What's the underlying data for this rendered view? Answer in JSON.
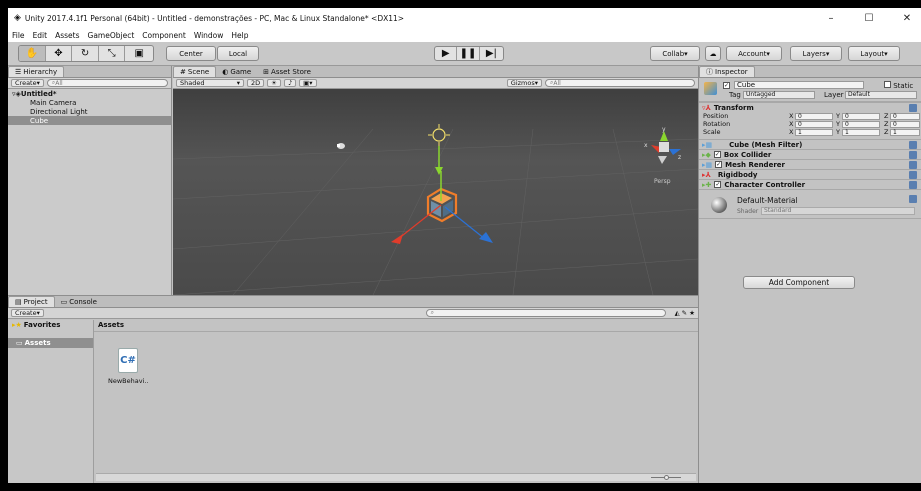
{
  "window": {
    "title": "Unity 2017.4.1f1 Personal (64bit) - Untitled - demonstrações - PC, Mac & Linux Standalone* <DX11>",
    "minimize": "–",
    "maximize": "☐",
    "close": "✕"
  },
  "menu": [
    "File",
    "Edit",
    "Assets",
    "GameObject",
    "Component",
    "Window",
    "Help"
  ],
  "toolbar": {
    "center_label": "Center",
    "local_label": "Local",
    "collab_label": "Collab",
    "account_label": "Account",
    "layers_label": "Layers",
    "layout_label": "Layout"
  },
  "hierarchy": {
    "tab": "Hierarchy",
    "create": "Create",
    "search": "All",
    "scene": "Untitled*",
    "items": [
      "Main Camera",
      "Directional Light",
      "Cube"
    ]
  },
  "scene": {
    "tabs": [
      "Scene",
      "Game",
      "Asset Store"
    ],
    "shading": "Shaded",
    "mode2d": "2D",
    "gizmos": "Gizmos",
    "search": "All",
    "persp": "Persp",
    "axis_x": "x",
    "axis_y": "y",
    "axis_z": "z"
  },
  "project": {
    "tabs": [
      "Project",
      "Console"
    ],
    "create": "Create",
    "favorites": "Favorites",
    "assets_header": "Assets",
    "assets_folder": "Assets",
    "file_name": "NewBehavi..",
    "file_icon": "C#"
  },
  "inspector": {
    "tab": "Inspector",
    "object_name": "Cube",
    "static_label": "Static",
    "tag_label": "Tag",
    "tag_value": "Untagged",
    "layer_label": "Layer",
    "layer_value": "Default",
    "transform": {
      "title": "Transform",
      "rows": [
        {
          "label": "Position",
          "x": "0",
          "y": "0",
          "z": "0"
        },
        {
          "label": "Rotation",
          "x": "0",
          "y": "0",
          "z": "0"
        },
        {
          "label": "Scale",
          "x": "1",
          "y": "1",
          "z": "1"
        }
      ]
    },
    "components": [
      "Cube (Mesh Filter)",
      "Box Collider",
      "Mesh Renderer",
      "Rigidbody",
      "Character Controller"
    ],
    "material_name": "Default-Material",
    "shader_label": "Shader",
    "shader_value": "Standard",
    "add_component": "Add Component"
  },
  "colors": {
    "scene_bg": "#4b4b4b",
    "cube_orange": "#f07d2a",
    "selection": "#8f8f8f"
  }
}
